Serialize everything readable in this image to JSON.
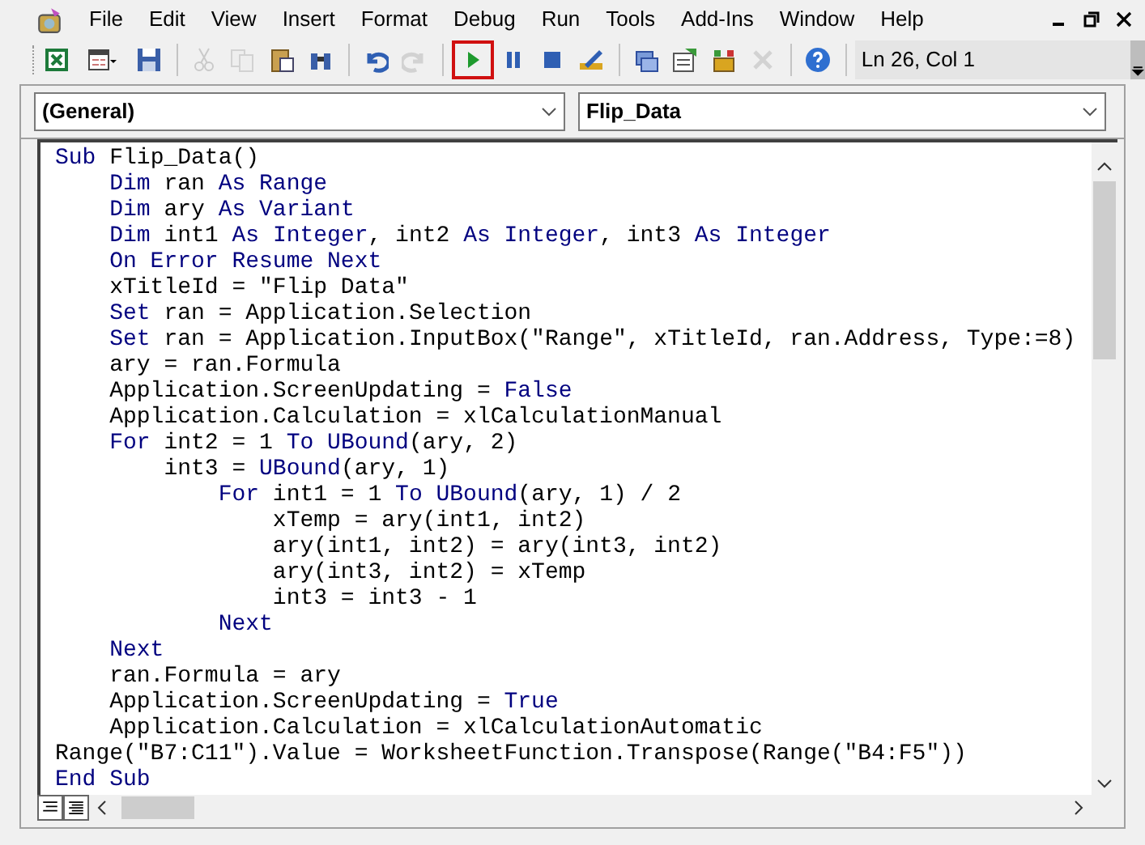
{
  "menu": [
    {
      "label": "File"
    },
    {
      "label": "Edit"
    },
    {
      "label": "View"
    },
    {
      "label": "Insert"
    },
    {
      "label": "Format"
    },
    {
      "label": "Debug"
    },
    {
      "label": "Run"
    },
    {
      "label": "Tools"
    },
    {
      "label": "Add-Ins"
    },
    {
      "label": "Window"
    },
    {
      "label": "Help"
    }
  ],
  "toolbar": [
    {
      "kind": "excel",
      "disabled": false,
      "highlighted": false
    },
    {
      "kind": "userform",
      "disabled": false,
      "highlighted": false
    },
    {
      "kind": "save",
      "disabled": false,
      "highlighted": false
    },
    {
      "kind": "separator"
    },
    {
      "kind": "cut",
      "disabled": true,
      "highlighted": false
    },
    {
      "kind": "copy",
      "disabled": true,
      "highlighted": false
    },
    {
      "kind": "paste",
      "disabled": false,
      "highlighted": false
    },
    {
      "kind": "find",
      "disabled": false,
      "highlighted": false
    },
    {
      "kind": "separator"
    },
    {
      "kind": "undo",
      "disabled": false,
      "highlighted": false
    },
    {
      "kind": "redo",
      "disabled": true,
      "highlighted": false
    },
    {
      "kind": "separator"
    },
    {
      "kind": "run",
      "disabled": false,
      "highlighted": true
    },
    {
      "kind": "pause",
      "disabled": false,
      "highlighted": false
    },
    {
      "kind": "stop",
      "disabled": false,
      "highlighted": false
    },
    {
      "kind": "design",
      "disabled": false,
      "highlighted": false
    },
    {
      "kind": "separator"
    },
    {
      "kind": "project",
      "disabled": false,
      "highlighted": false
    },
    {
      "kind": "properties",
      "disabled": false,
      "highlighted": false
    },
    {
      "kind": "browser",
      "disabled": false,
      "highlighted": false
    },
    {
      "kind": "toolbox",
      "disabled": true,
      "highlighted": false
    },
    {
      "kind": "separator"
    },
    {
      "kind": "help",
      "disabled": false,
      "highlighted": false
    },
    {
      "kind": "separator"
    }
  ],
  "status": "Ln 26, Col 1",
  "object_dropdown": {
    "value": "(General)"
  },
  "procedure_dropdown": {
    "value": "Flip_Data"
  },
  "code": [
    [
      {
        "text": "Sub ",
        "kind": "keyword"
      },
      {
        "text": "Flip_Data()",
        "kind": "plain"
      }
    ],
    [
      {
        "text": "    Dim ",
        "kind": "keyword"
      },
      {
        "text": "ran ",
        "kind": "plain"
      },
      {
        "text": "As Range",
        "kind": "keyword"
      }
    ],
    [
      {
        "text": "    Dim ",
        "kind": "keyword"
      },
      {
        "text": "ary ",
        "kind": "plain"
      },
      {
        "text": "As Variant",
        "kind": "keyword"
      }
    ],
    [
      {
        "text": "    Dim ",
        "kind": "keyword"
      },
      {
        "text": "int1 ",
        "kind": "plain"
      },
      {
        "text": "As Integer",
        "kind": "keyword"
      },
      {
        "text": ", int2 ",
        "kind": "plain"
      },
      {
        "text": "As Integer",
        "kind": "keyword"
      },
      {
        "text": ", int3 ",
        "kind": "plain"
      },
      {
        "text": "As Integer",
        "kind": "keyword"
      }
    ],
    [
      {
        "text": "    On Error Resume Next",
        "kind": "keyword"
      }
    ],
    [
      {
        "text": "    xTitleId = \"Flip Data\"",
        "kind": "plain"
      }
    ],
    [
      {
        "text": "    Set ",
        "kind": "keyword"
      },
      {
        "text": "ran = Application.Selection",
        "kind": "plain"
      }
    ],
    [
      {
        "text": "    Set ",
        "kind": "keyword"
      },
      {
        "text": "ran = Application.InputBox(\"Range\", xTitleId, ran.Address, Type:=8)",
        "kind": "plain"
      }
    ],
    [
      {
        "text": "    ary = ran.Formula",
        "kind": "plain"
      }
    ],
    [
      {
        "text": "    Application.ScreenUpdating = ",
        "kind": "plain"
      },
      {
        "text": "False",
        "kind": "keyword"
      }
    ],
    [
      {
        "text": "    Application.Calculation = xlCalculationManual",
        "kind": "plain"
      }
    ],
    [
      {
        "text": "    For ",
        "kind": "keyword"
      },
      {
        "text": "int2 = 1 ",
        "kind": "plain"
      },
      {
        "text": "To UBound",
        "kind": "keyword"
      },
      {
        "text": "(ary, 2)",
        "kind": "plain"
      }
    ],
    [
      {
        "text": "        int3 = ",
        "kind": "plain"
      },
      {
        "text": "UBound",
        "kind": "keyword"
      },
      {
        "text": "(ary, 1)",
        "kind": "plain"
      }
    ],
    [
      {
        "text": "            For ",
        "kind": "keyword"
      },
      {
        "text": "int1 = 1 ",
        "kind": "plain"
      },
      {
        "text": "To UBound",
        "kind": "keyword"
      },
      {
        "text": "(ary, 1) / 2",
        "kind": "plain"
      }
    ],
    [
      {
        "text": "                xTemp = ary(int1, int2)",
        "kind": "plain"
      }
    ],
    [
      {
        "text": "                ary(int1, int2) = ary(int3, int2)",
        "kind": "plain"
      }
    ],
    [
      {
        "text": "                ary(int3, int2) = xTemp",
        "kind": "plain"
      }
    ],
    [
      {
        "text": "                int3 = int3 - 1",
        "kind": "plain"
      }
    ],
    [
      {
        "text": "            Next",
        "kind": "keyword"
      }
    ],
    [
      {
        "text": "    Next",
        "kind": "keyword"
      }
    ],
    [
      {
        "text": "    ran.Formula = ary",
        "kind": "plain"
      }
    ],
    [
      {
        "text": "    Application.ScreenUpdating = ",
        "kind": "plain"
      },
      {
        "text": "True",
        "kind": "keyword"
      }
    ],
    [
      {
        "text": "    Application.Calculation = xlCalculationAutomatic",
        "kind": "plain"
      }
    ],
    [
      {
        "text": "Range(\"B7:C11\").Value = WorksheetFunction.Transpose(Range(\"B4:F5\"))",
        "kind": "plain"
      }
    ],
    [
      {
        "text": "End Sub",
        "kind": "keyword"
      }
    ]
  ]
}
